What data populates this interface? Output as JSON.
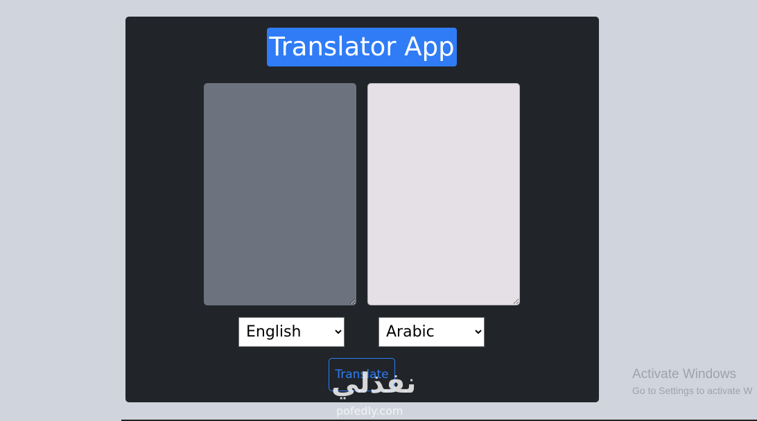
{
  "app": {
    "title": "Translator App",
    "accent_color": "#2f7cf6",
    "card_background": "#212529"
  },
  "editor": {
    "source_text": "",
    "target_text": ""
  },
  "languages": {
    "from_selected": "English",
    "to_selected": "Arabic"
  },
  "actions": {
    "translate_label": "Translate"
  },
  "watermark": {
    "arabic": "نفذلي",
    "latin": "pofedly.com"
  },
  "os_overlay": {
    "title": "Activate Windows",
    "subtitle": "Go to Settings to activate W"
  }
}
